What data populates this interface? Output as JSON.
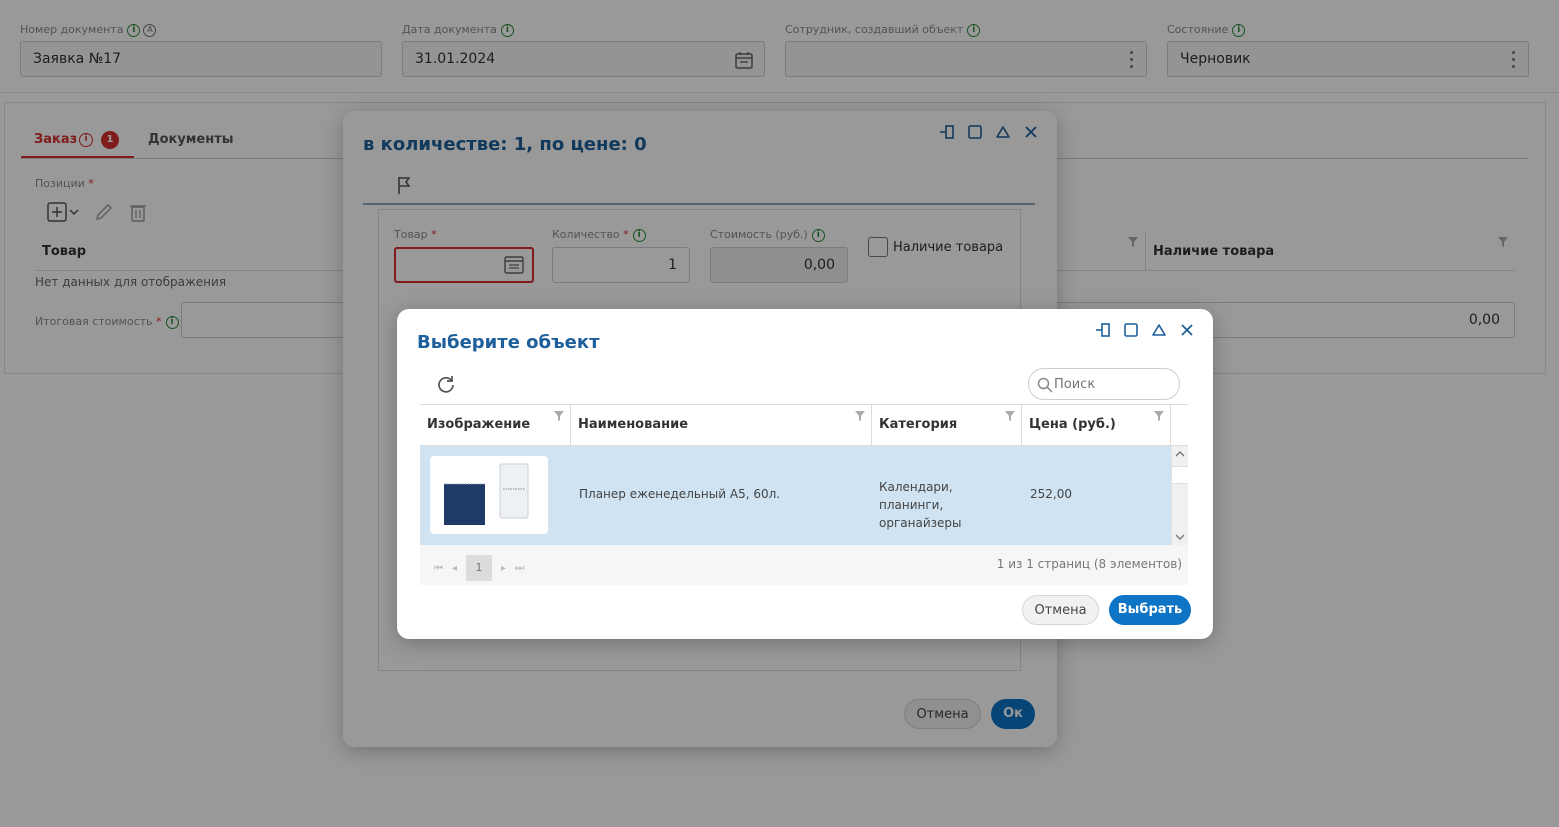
{
  "header": {
    "doc_number": {
      "label": "Номер документа",
      "value": "Заявка №17"
    },
    "doc_date": {
      "label": "Дата документа",
      "value": "31.01.2024"
    },
    "employee": {
      "label": "Сотрудник, создавший объект",
      "value": ""
    },
    "state": {
      "label": "Состояние",
      "value": "Черновик"
    }
  },
  "tabs": [
    {
      "label": "Заказ",
      "badge": "1"
    },
    {
      "label": "Документы"
    }
  ],
  "positions": {
    "label": "Позиции",
    "col_product": "Товар",
    "col_availability": "Наличие товара",
    "empty_text": "Нет данных для отображения",
    "total_label": "Итоговая стоимость",
    "total_value": "0,00"
  },
  "edit_dialog": {
    "title": "в количестве: 1, по цене: 0",
    "product_label": "Товар",
    "quantity_label": "Количество",
    "quantity_value": "1",
    "cost_label": "Стоимость (руб.)",
    "cost_value": "0,00",
    "availability_label": "Наличие товара",
    "cancel": "Отмена",
    "ok": "Ок"
  },
  "select_dialog": {
    "title": "Выберите объект",
    "search_placeholder": "Поиск",
    "columns": [
      "Изображение",
      "Наименование",
      "Категория",
      "Цена (руб.)"
    ],
    "rows": [
      {
        "name": "Планер еженедельный А5, 60л.",
        "category": "Календари, планинги, органайзеры",
        "price": "252,00"
      }
    ],
    "pager_page": "1",
    "pager_info": "1 из 1 страниц (8 элементов)",
    "cancel": "Отмена",
    "select": "Выбрать"
  },
  "colors": {
    "accent": "#0d74c6",
    "title": "#1d5f9a",
    "error": "#d53030",
    "info": "#2e8b3a",
    "selected_row": "#cfe3f2"
  }
}
